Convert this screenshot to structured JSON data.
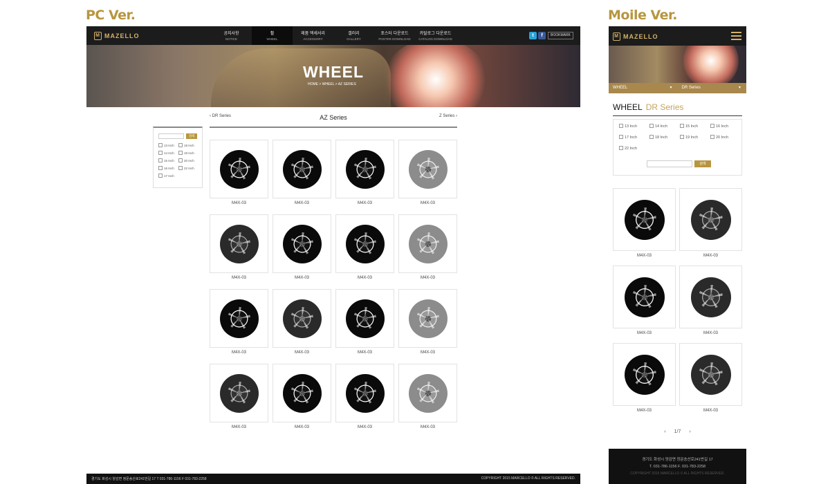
{
  "labels": {
    "pc": "PC Ver.",
    "mobile": "Moile Ver."
  },
  "brand": "MAZELLO",
  "nav": [
    {
      "ko": "공지사항",
      "en": "NOTICE"
    },
    {
      "ko": "휠",
      "en": "WHEEL"
    },
    {
      "ko": "제품 액세서리",
      "en": "ACCESSORY"
    },
    {
      "ko": "갤러리",
      "en": "GALLERY"
    },
    {
      "ko": "포스터 다운로드",
      "en": "POSTER DOWNLOAD"
    },
    {
      "ko": "카탈로그 다운로드",
      "en": "CATALOG DOWNLOAD"
    }
  ],
  "sns": {
    "twitter": "t",
    "facebook": "f",
    "bookmark": "BOOKMARK"
  },
  "hero": {
    "title": "WHEEL",
    "breadcrumb": "HOME  >  WHEEL  >  AZ SERIES"
  },
  "series": {
    "prev": "DR Series",
    "current": "AZ Series",
    "next": "Z Series"
  },
  "search": {
    "button": "검색"
  },
  "pc_sizes": [
    "13 Inch",
    "18 Inch",
    "14 Inch",
    "19 Inch",
    "15 Inch",
    "20 Inch",
    "16 Inch",
    "22 Inch",
    "17 Inch"
  ],
  "pc_products": [
    {
      "name": "M4X-03",
      "finish": "black"
    },
    {
      "name": "M4X-03",
      "finish": "black"
    },
    {
      "name": "M4X-03",
      "finish": "black"
    },
    {
      "name": "M4X-03",
      "finish": "silver"
    },
    {
      "name": "M4X-03",
      "finish": "gunmetal"
    },
    {
      "name": "M4X-03",
      "finish": "black"
    },
    {
      "name": "M4X-03",
      "finish": "black"
    },
    {
      "name": "M4X-03",
      "finish": "silver"
    },
    {
      "name": "M4X-03",
      "finish": "black"
    },
    {
      "name": "M4X-03",
      "finish": "gunmetal"
    },
    {
      "name": "M4X-03",
      "finish": "black"
    },
    {
      "name": "M4X-03",
      "finish": "silver"
    },
    {
      "name": "M4X-03",
      "finish": "gunmetal"
    },
    {
      "name": "M4X-03",
      "finish": "black"
    },
    {
      "name": "M4X-03",
      "finish": "black"
    },
    {
      "name": "M4X-03",
      "finish": "silver"
    }
  ],
  "pc_footer": {
    "address": "경기도 화성시 양감면 정문송산로241번길 17    T  031-786-1156    F  031-783-2258",
    "copyright": "COPYRIGHT 2015 MARCELLO © ALL RIGHTS RESERVED."
  },
  "mobile": {
    "select_1": "WHEEL",
    "select_2": "DR Series",
    "title": "WHEEL",
    "subtitle": "DR Series",
    "sizes": [
      "13 Inch",
      "14 Inch",
      "15 Inch",
      "16 Inch",
      "17 Inch",
      "18 Inch",
      "19 Inch",
      "20 Inch",
      "22 Inch"
    ],
    "products": [
      {
        "name": "M4X-03",
        "finish": "black"
      },
      {
        "name": "M4X-03",
        "finish": "gunmetal"
      },
      {
        "name": "M4X-03",
        "finish": "black"
      },
      {
        "name": "M4X-03",
        "finish": "gunmetal"
      },
      {
        "name": "M4X-03",
        "finish": "black"
      },
      {
        "name": "M4X-03",
        "finish": "gunmetal"
      }
    ],
    "pager": "1/7",
    "footer_address": "경기도 화성시 양감면 정문송산로241번길 17",
    "footer_contact": "T. 031-786-1156   F. 031-783-2258",
    "footer_copyright": "COPYRIGHT 2015 MARCELLO © ALL RIGHTS RESERVED."
  },
  "colors": {
    "accent": "#b8963f",
    "dark": "#1c1c1c"
  }
}
